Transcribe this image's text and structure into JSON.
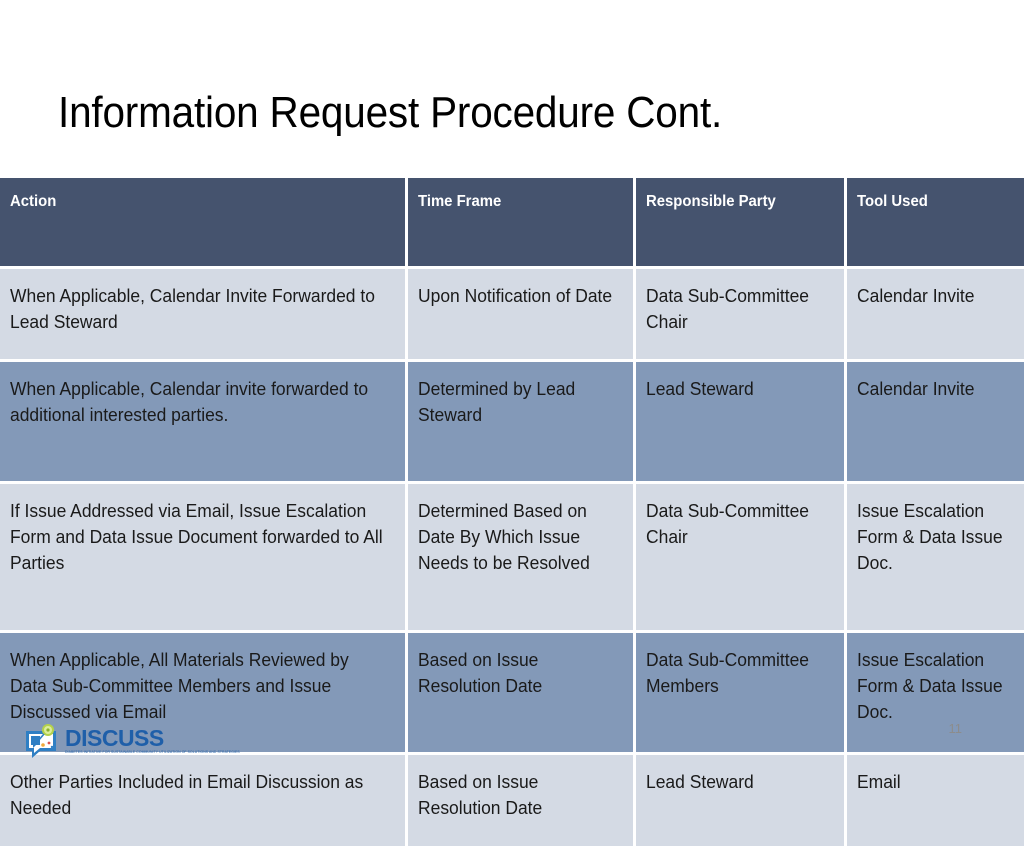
{
  "slide": {
    "title": "Information Request Procedure Cont.",
    "page_number": "11"
  },
  "table": {
    "columns": [
      {
        "key": "action",
        "label": "Action"
      },
      {
        "key": "time_frame",
        "label": "Time Frame"
      },
      {
        "key": "responsible_party",
        "label": "Responsible Party"
      },
      {
        "key": "tool_used",
        "label": "Tool Used"
      }
    ],
    "rows": [
      {
        "shade": "light",
        "action": "When Applicable, Calendar Invite Forwarded to Lead Steward",
        "time_frame": "Upon Notification of Date",
        "responsible_party": "Data Sub-Committee Chair",
        "tool_used": "Calendar Invite"
      },
      {
        "shade": "dark",
        "action": "When Applicable, Calendar invite forwarded to additional interested parties.",
        "time_frame": "Determined by Lead Steward",
        "responsible_party": "Lead Steward",
        "tool_used": "Calendar Invite"
      },
      {
        "shade": "light",
        "action": "If Issue Addressed via Email, Issue Escalation Form and Data Issue Document forwarded to All Parties",
        "time_frame": "Determined Based on Date By Which Issue Needs to be Resolved",
        "responsible_party": "Data Sub-Committee Chair",
        "tool_used": "Issue Escalation Form & Data Issue Doc."
      },
      {
        "shade": "dark",
        "action": "When Applicable, All Materials Reviewed by Data Sub-Committee Members and Issue Discussed via Email",
        "time_frame": "Based on Issue Resolution Date",
        "responsible_party": "Data Sub-Committee Members",
        "tool_used": "Issue Escalation Form & Data Issue Doc."
      },
      {
        "shade": "light",
        "action": "Other Parties Included in Email Discussion as Needed",
        "time_frame": "Based on Issue Resolution Date",
        "responsible_party": "Lead Steward",
        "tool_used": "Email"
      }
    ]
  },
  "footer": {
    "logo_name": "DISCUSS",
    "logo_tagline": "DIABETES INITIATIVE FOR SUSTAINABLE COMMUNITY UTILIZATION OF SOLUTIONS AND STRATEGIES",
    "logo_icon": "speech-bubble-icon"
  },
  "colors": {
    "header_background": "#45536e",
    "row_light": "#d4dae4",
    "row_dark": "#8399b8",
    "text": "#1a1a1a",
    "header_text": "#ffffff",
    "page_number": "#8c8c8c",
    "logo_blue": "#1f5fa9"
  }
}
